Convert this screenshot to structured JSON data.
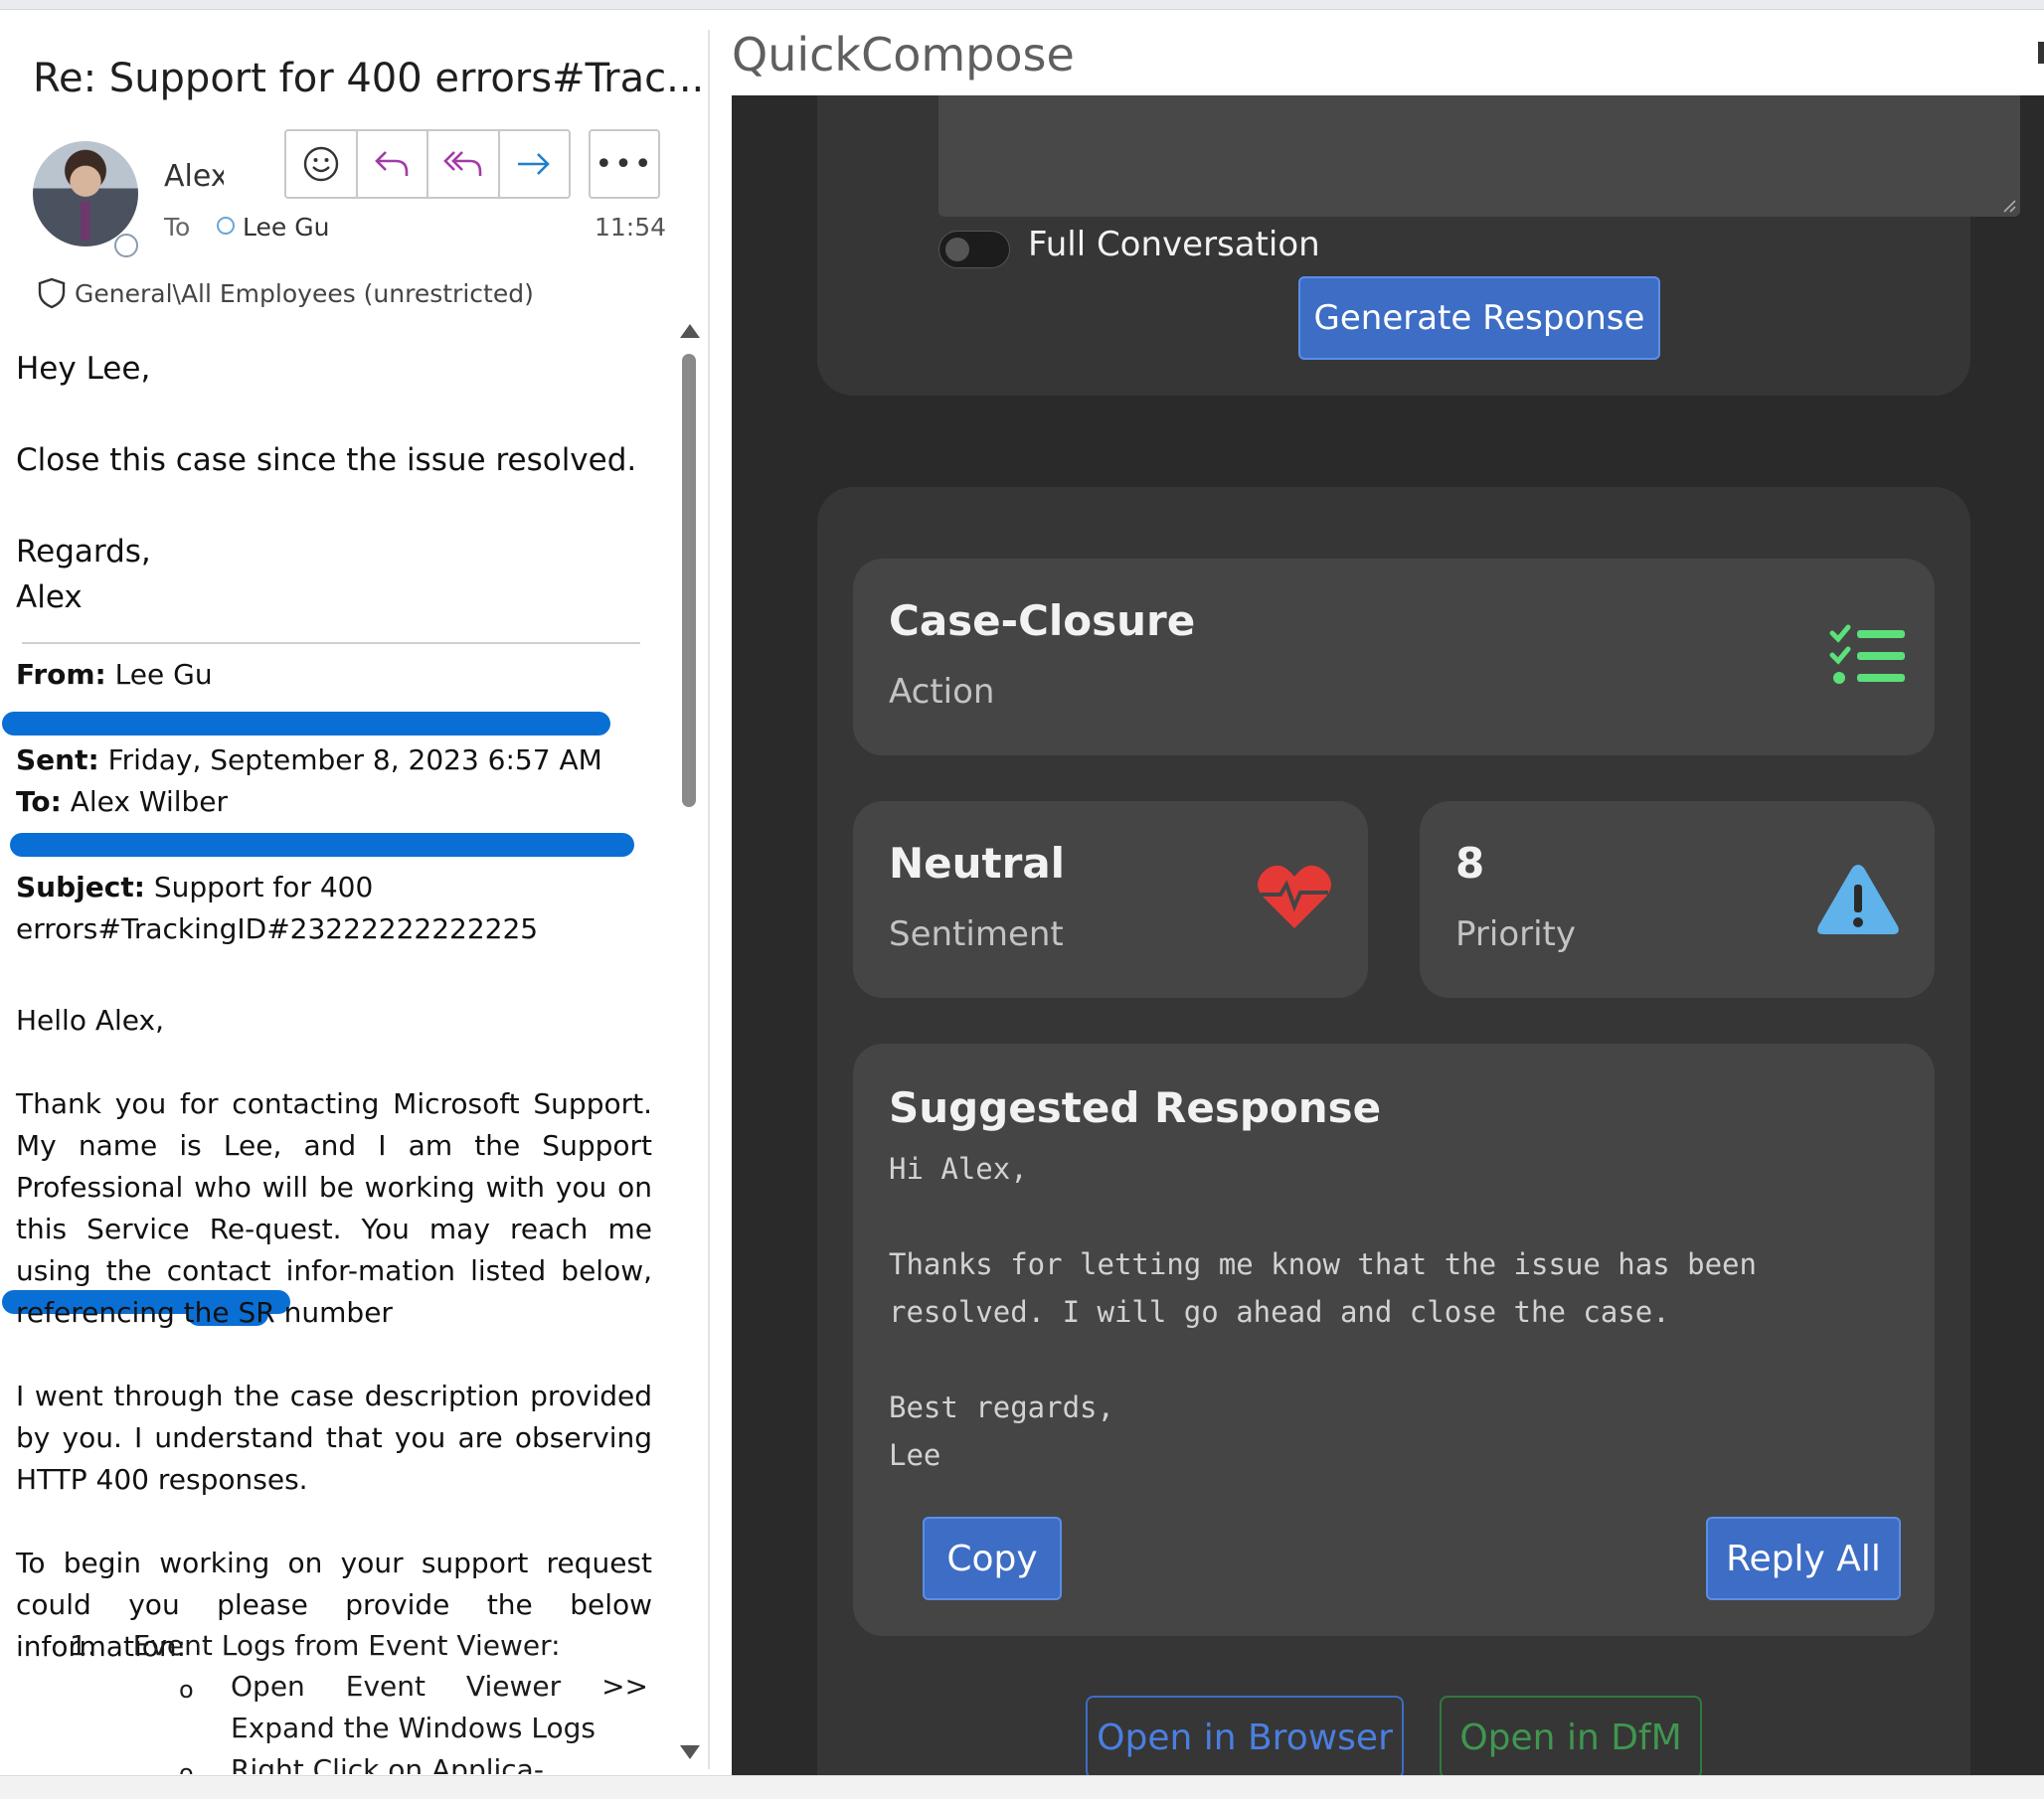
{
  "email": {
    "subject": "Re: Support for 400 errors#Trac...",
    "sender": "Alex Wilber",
    "to_label": "To",
    "to_name": "Lee Gu",
    "time": "11:54",
    "sensitivity": "General\\All Employees (unrestricted)",
    "greeting": "Hey Lee,",
    "line1": "Close this case since the issue resolved.",
    "regards": "Regards,",
    "signoff": "Alex",
    "fwd": {
      "from_label": "From:",
      "from_value": "Lee Gu",
      "sent_label": "Sent:",
      "sent_value": "Friday, September 8, 2023 6:57 AM",
      "to_label": "To:",
      "to_value": "Alex Wilber",
      "subject_label": "Subject:",
      "subject_value_1": "Support for 400",
      "subject_value_2": "errors#TrackingID#23222222222225"
    },
    "hello": "Hello Alex,",
    "p1": "Thank you for contacting Microsoft Support. My name is Lee, and I am the Support Professional who will be working with you on this Service Re-quest. You may reach me using the contact infor-mation listed below, referencing the SR number",
    "p2": "I went through the case description provided by you. I understand that you are observing HTTP 400 responses.",
    "p3": "To begin working on your support request could you please provide the below information:",
    "list_num": "1.",
    "list_item": "Event Logs from Event Viewer:",
    "sub1": "Open Event Viewer >> Expand the Windows Logs",
    "sub2": "Right Click on Applica-",
    "bullet": "o"
  },
  "quickcompose": {
    "title": "QuickCompose",
    "toggle_label": "Full Conversation",
    "generate_label": "Generate Response",
    "action": {
      "title": "Case-Closure",
      "subtitle": "Action",
      "icon_color": "#5be07a"
    },
    "sentiment": {
      "title": "Neutral",
      "subtitle": "Sentiment",
      "icon_color": "#e53935"
    },
    "priority": {
      "title": "8",
      "subtitle": "Priority",
      "icon_color": "#5fb3ea"
    },
    "suggested": {
      "title": "Suggested Response",
      "body": "Hi Alex,\n\nThanks for letting me know that the issue has been\nresolved. I will go ahead and close the case.\n\nBest regards,\nLee"
    },
    "copy_label": "Copy",
    "reply_all_label": "Reply All",
    "open_browser_label": "Open in Browser",
    "open_dfm_label": "Open in DfM",
    "accent": "#3d6dc4"
  }
}
